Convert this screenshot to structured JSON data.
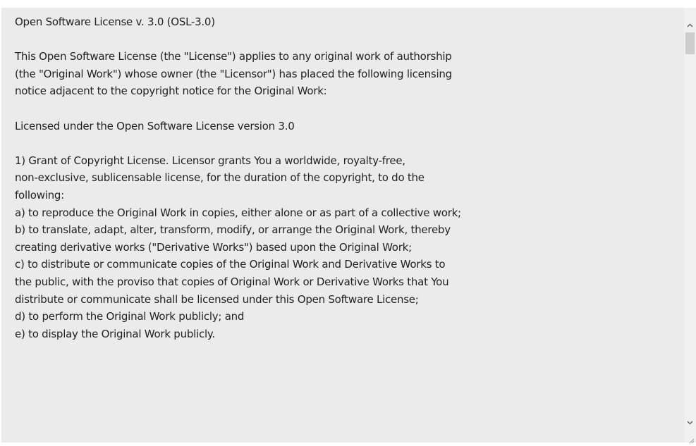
{
  "license": {
    "text": "Open Software License v. 3.0 (OSL-3.0)\n\nThis Open Software License (the \"License\") applies to any original work of authorship\n(the \"Original Work\") whose owner (the \"Licensor\") has placed the following licensing\nnotice adjacent to the copyright notice for the Original Work:\n\nLicensed under the Open Software License version 3.0\n\n1) Grant of Copyright License. Licensor grants You a worldwide, royalty-free,\nnon-exclusive, sublicensable license, for the duration of the copyright, to do the\nfollowing:\na) to reproduce the Original Work in copies, either alone or as part of a collective work;\nb) to translate, adapt, alter, transform, modify, or arrange the Original Work, thereby\ncreating derivative works (\"Derivative Works\") based upon the Original Work;\nc) to distribute or communicate copies of the Original Work and Derivative Works to\nthe public, with the proviso that copies of Original Work or Derivative Works that You\ndistribute or communicate shall be licensed under this Open Software License;\nd) to perform the Original Work publicly; and\ne) to display the Original Work publicly."
  },
  "scrollbar": {
    "up_icon": "chevron-up-icon",
    "down_icon": "chevron-down-icon",
    "position": 0.0
  },
  "colors": {
    "box_background": "#ebebeb",
    "text": "#222222",
    "scroll_thumb": "#cdcdcd"
  }
}
